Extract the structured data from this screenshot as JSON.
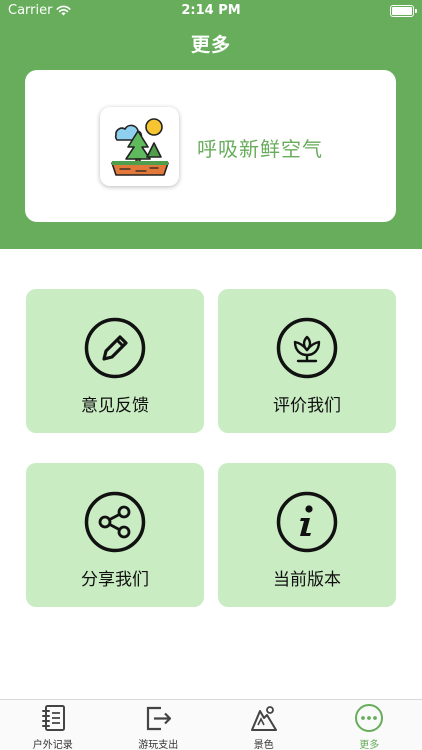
{
  "status_bar": {
    "carrier": "Carrier",
    "time": "2:14 PM"
  },
  "nav": {
    "title": "更多"
  },
  "app": {
    "name": "呼吸新鲜空气",
    "icon": "landscape-app-icon"
  },
  "tiles": [
    {
      "label": "意见反馈",
      "icon": "pencil-icon"
    },
    {
      "label": "评价我们",
      "icon": "flower-icon"
    },
    {
      "label": "分享我们",
      "icon": "share-icon"
    },
    {
      "label": "当前版本",
      "icon": "info-icon"
    }
  ],
  "tabs": [
    {
      "label": "户外记录",
      "icon": "notebook-icon",
      "active": false
    },
    {
      "label": "游玩支出",
      "icon": "exit-icon",
      "active": false
    },
    {
      "label": "景色",
      "icon": "mountain-icon",
      "active": false
    },
    {
      "label": "更多",
      "icon": "more-icon",
      "active": true
    }
  ],
  "colors": {
    "primary": "#67ad5b",
    "tile_bg": "#c9ecc3"
  }
}
